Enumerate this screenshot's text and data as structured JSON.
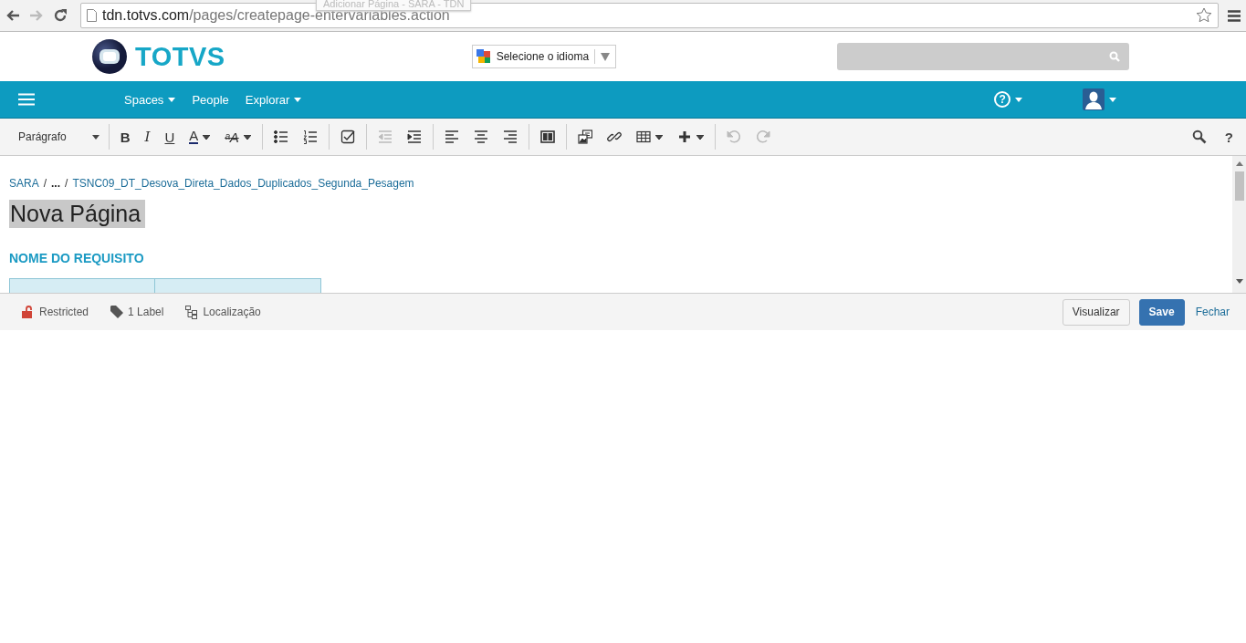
{
  "browser": {
    "tooltip": "Adicionar Página - SARA - TDN",
    "url_host": "tdn.totvs.com",
    "url_path": "/pages/createpage-entervariables.action"
  },
  "header": {
    "logo_text": "TOTVS",
    "language_select": "Selecione o idioma"
  },
  "nav": {
    "items": [
      {
        "label": "Spaces",
        "dropdown": true
      },
      {
        "label": "People",
        "dropdown": false
      },
      {
        "label": "Explorar",
        "dropdown": true
      }
    ],
    "help_glyph": "?"
  },
  "toolbar": {
    "format": "Parágrafo",
    "groups": [
      [
        {
          "kind": "bold",
          "glyph": "B",
          "dropdown": false,
          "disabled": false
        },
        {
          "kind": "italic",
          "glyph": "I",
          "dropdown": false,
          "disabled": false
        },
        {
          "kind": "underline",
          "glyph": "U",
          "dropdown": false,
          "disabled": false
        },
        {
          "kind": "color",
          "glyph": "A",
          "dropdown": true,
          "disabled": false
        },
        {
          "kind": "style",
          "glyph": "ᵃA",
          "dropdown": true,
          "disabled": false
        }
      ],
      [
        {
          "kind": "bullets",
          "dropdown": false,
          "disabled": false
        },
        {
          "kind": "numbers",
          "dropdown": false,
          "disabled": false
        }
      ],
      [
        {
          "kind": "task",
          "dropdown": false,
          "disabled": false
        }
      ],
      [
        {
          "kind": "outdent",
          "dropdown": false,
          "disabled": true
        },
        {
          "kind": "indent",
          "dropdown": false,
          "disabled": false
        }
      ],
      [
        {
          "kind": "align-left",
          "dropdown": false,
          "disabled": false
        },
        {
          "kind": "align-center",
          "dropdown": false,
          "disabled": false
        },
        {
          "kind": "align-right",
          "dropdown": false,
          "disabled": false
        }
      ],
      [
        {
          "kind": "layout",
          "dropdown": false,
          "disabled": false
        }
      ],
      [
        {
          "kind": "image",
          "dropdown": false,
          "disabled": false
        },
        {
          "kind": "link",
          "dropdown": false,
          "disabled": false
        },
        {
          "kind": "table",
          "dropdown": true,
          "disabled": false
        },
        {
          "kind": "plus",
          "dropdown": true,
          "disabled": false
        }
      ],
      [
        {
          "kind": "undo",
          "dropdown": false,
          "disabled": true
        },
        {
          "kind": "redo",
          "dropdown": false,
          "disabled": true
        }
      ]
    ],
    "help_glyph": "?"
  },
  "breadcrumb": [
    {
      "kind": "link",
      "text": "SARA"
    },
    {
      "kind": "separator",
      "text": "/"
    },
    {
      "kind": "ellipsis",
      "text": "..."
    },
    {
      "kind": "separator",
      "text": "/"
    },
    {
      "kind": "link",
      "text": "TSNC09_DT_Desova_Direta_Dados_Duplicados_Segunda_Pesagem"
    }
  ],
  "page_title": {
    "text": "Nova Página",
    "highlighted": true
  },
  "section_heading": "NOME DO REQUISITO",
  "footer": {
    "items": [
      {
        "kind": "lock",
        "label": "Restricted"
      },
      {
        "kind": "tag",
        "label": "1 Label"
      },
      {
        "kind": "tree",
        "label": "Localização"
      }
    ],
    "buttons": [
      {
        "kind": "default",
        "label": "Visualizar"
      },
      {
        "kind": "primary",
        "label": "Save"
      },
      {
        "kind": "link",
        "label": "Fechar"
      }
    ]
  }
}
